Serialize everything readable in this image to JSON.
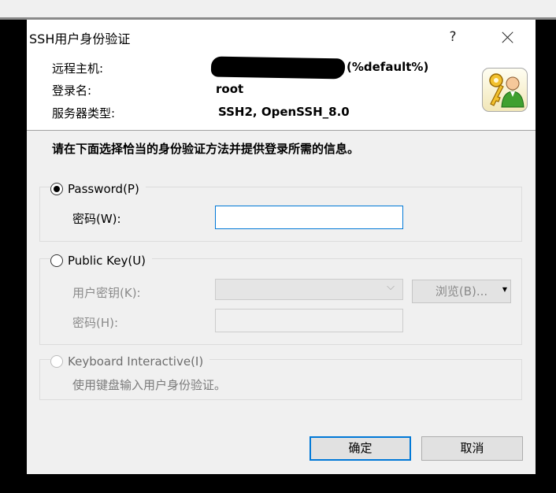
{
  "dialog": {
    "title": "SSH用户身份验证",
    "help_label": "?"
  },
  "info": {
    "host_label": "远程主机:",
    "host_value_suffix": "(%default%)",
    "login_label": "登录名:",
    "login_value": "root",
    "server_type_label": "服务器类型:",
    "server_type_value": "SSH2, OpenSSH_8.0"
  },
  "instruction": "请在下面选择恰当的身份验证方法并提供登录所需的信息。",
  "password_group": {
    "label": "Password(P)",
    "selected": true,
    "field_label": "密码(W):",
    "field_value": ""
  },
  "publickey_group": {
    "label": "Public Key(U)",
    "selected": false,
    "key_label": "用户密钥(K):",
    "key_value": "",
    "browse_label": "浏览(B)...",
    "passphrase_label": "密码(H):",
    "passphrase_value": ""
  },
  "keyboard_group": {
    "label": "Keyboard Interactive(I)",
    "enabled": false,
    "hint": "使用键盘输入用户身份验证。"
  },
  "buttons": {
    "ok_label": "确定",
    "cancel_label": "取消"
  }
}
